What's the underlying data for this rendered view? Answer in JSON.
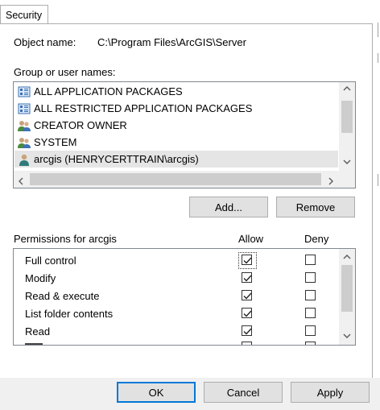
{
  "tab": {
    "label": "Security"
  },
  "object": {
    "label": "Object name:",
    "value": "C:\\Program Files\\ArcGIS\\Server"
  },
  "groups": {
    "label": "Group or user names:",
    "items": [
      {
        "label": "ALL APPLICATION PACKAGES",
        "icon": "package-icon"
      },
      {
        "label": "ALL RESTRICTED APPLICATION PACKAGES",
        "icon": "package-icon"
      },
      {
        "label": "CREATOR OWNER",
        "icon": "users-icon"
      },
      {
        "label": "SYSTEM",
        "icon": "users-icon"
      },
      {
        "label": "arcgis (HENRYCERTTRAIN\\arcgis)",
        "icon": "user-icon",
        "selected": true
      }
    ]
  },
  "actions": {
    "add": "Add...",
    "remove": "Remove"
  },
  "permissions": {
    "label": "Permissions for arcgis",
    "allow_header": "Allow",
    "deny_header": "Deny",
    "rows": [
      {
        "label": "Full control",
        "allow": true,
        "deny": false
      },
      {
        "label": "Modify",
        "allow": true,
        "deny": false
      },
      {
        "label": "Read & execute",
        "allow": true,
        "deny": false
      },
      {
        "label": "List folder contents",
        "allow": true,
        "deny": false
      },
      {
        "label": "Read",
        "allow": true,
        "deny": false
      }
    ]
  },
  "footer": {
    "ok": "OK",
    "cancel": "Cancel",
    "apply": "Apply"
  },
  "colors": {
    "accent": "#0078d7",
    "selection": "#e5e5e5"
  }
}
